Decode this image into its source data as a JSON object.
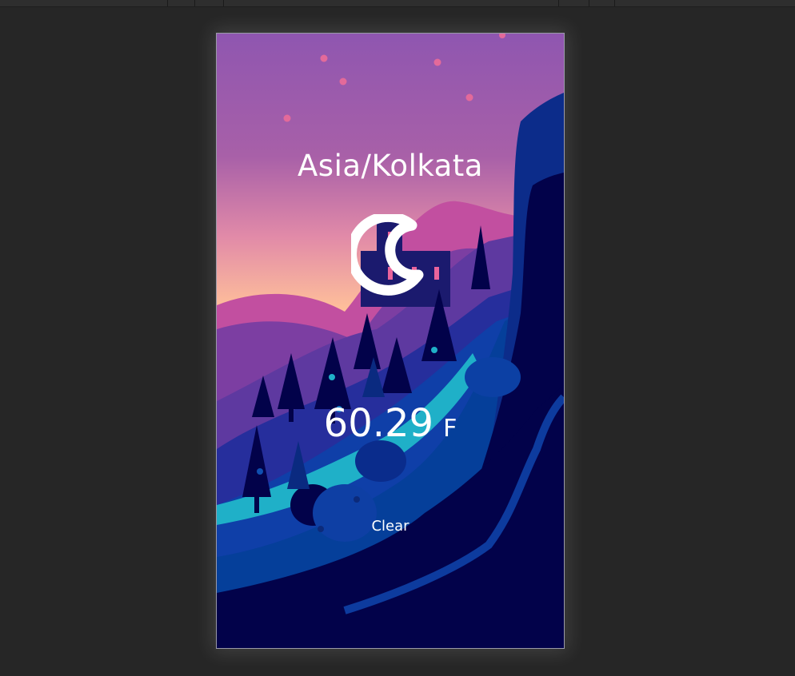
{
  "weather": {
    "city": "Asia/Kolkata",
    "condition_icon": "moon-icon",
    "temperature": "60.29",
    "unit": "F",
    "condition": "Clear"
  },
  "colors": {
    "editor_background": "#262626",
    "sky_top": "#8f56b0",
    "sky_horizon": "#ffc09a",
    "night_ground": "#02024a",
    "text": "#ffffff"
  }
}
